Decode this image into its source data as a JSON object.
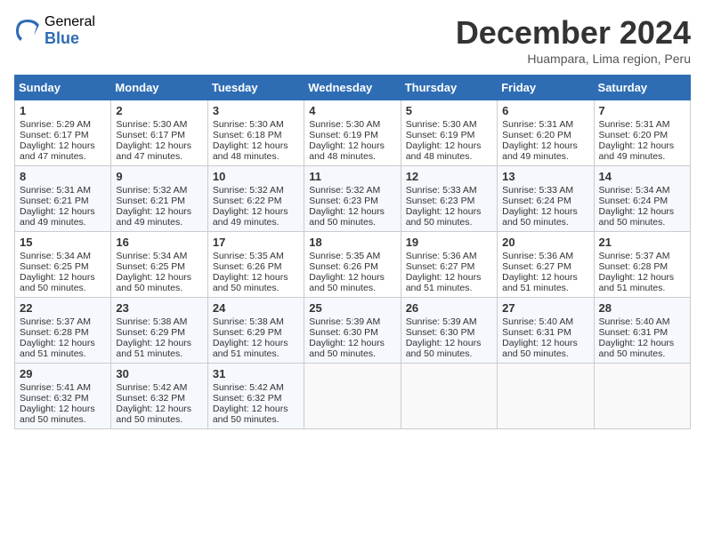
{
  "logo": {
    "general": "General",
    "blue": "Blue"
  },
  "title": "December 2024",
  "location": "Huampara, Lima region, Peru",
  "days_of_week": [
    "Sunday",
    "Monday",
    "Tuesday",
    "Wednesday",
    "Thursday",
    "Friday",
    "Saturday"
  ],
  "weeks": [
    [
      {
        "day": 1,
        "sunrise": "5:29 AM",
        "sunset": "6:17 PM",
        "daylight": "12 hours and 47 minutes."
      },
      {
        "day": 2,
        "sunrise": "5:30 AM",
        "sunset": "6:17 PM",
        "daylight": "12 hours and 47 minutes."
      },
      {
        "day": 3,
        "sunrise": "5:30 AM",
        "sunset": "6:18 PM",
        "daylight": "12 hours and 48 minutes."
      },
      {
        "day": 4,
        "sunrise": "5:30 AM",
        "sunset": "6:19 PM",
        "daylight": "12 hours and 48 minutes."
      },
      {
        "day": 5,
        "sunrise": "5:30 AM",
        "sunset": "6:19 PM",
        "daylight": "12 hours and 48 minutes."
      },
      {
        "day": 6,
        "sunrise": "5:31 AM",
        "sunset": "6:20 PM",
        "daylight": "12 hours and 49 minutes."
      },
      {
        "day": 7,
        "sunrise": "5:31 AM",
        "sunset": "6:20 PM",
        "daylight": "12 hours and 49 minutes."
      }
    ],
    [
      {
        "day": 8,
        "sunrise": "5:31 AM",
        "sunset": "6:21 PM",
        "daylight": "12 hours and 49 minutes."
      },
      {
        "day": 9,
        "sunrise": "5:32 AM",
        "sunset": "6:21 PM",
        "daylight": "12 hours and 49 minutes."
      },
      {
        "day": 10,
        "sunrise": "5:32 AM",
        "sunset": "6:22 PM",
        "daylight": "12 hours and 49 minutes."
      },
      {
        "day": 11,
        "sunrise": "5:32 AM",
        "sunset": "6:23 PM",
        "daylight": "12 hours and 50 minutes."
      },
      {
        "day": 12,
        "sunrise": "5:33 AM",
        "sunset": "6:23 PM",
        "daylight": "12 hours and 50 minutes."
      },
      {
        "day": 13,
        "sunrise": "5:33 AM",
        "sunset": "6:24 PM",
        "daylight": "12 hours and 50 minutes."
      },
      {
        "day": 14,
        "sunrise": "5:34 AM",
        "sunset": "6:24 PM",
        "daylight": "12 hours and 50 minutes."
      }
    ],
    [
      {
        "day": 15,
        "sunrise": "5:34 AM",
        "sunset": "6:25 PM",
        "daylight": "12 hours and 50 minutes."
      },
      {
        "day": 16,
        "sunrise": "5:34 AM",
        "sunset": "6:25 PM",
        "daylight": "12 hours and 50 minutes."
      },
      {
        "day": 17,
        "sunrise": "5:35 AM",
        "sunset": "6:26 PM",
        "daylight": "12 hours and 50 minutes."
      },
      {
        "day": 18,
        "sunrise": "5:35 AM",
        "sunset": "6:26 PM",
        "daylight": "12 hours and 50 minutes."
      },
      {
        "day": 19,
        "sunrise": "5:36 AM",
        "sunset": "6:27 PM",
        "daylight": "12 hours and 51 minutes."
      },
      {
        "day": 20,
        "sunrise": "5:36 AM",
        "sunset": "6:27 PM",
        "daylight": "12 hours and 51 minutes."
      },
      {
        "day": 21,
        "sunrise": "5:37 AM",
        "sunset": "6:28 PM",
        "daylight": "12 hours and 51 minutes."
      }
    ],
    [
      {
        "day": 22,
        "sunrise": "5:37 AM",
        "sunset": "6:28 PM",
        "daylight": "12 hours and 51 minutes."
      },
      {
        "day": 23,
        "sunrise": "5:38 AM",
        "sunset": "6:29 PM",
        "daylight": "12 hours and 51 minutes."
      },
      {
        "day": 24,
        "sunrise": "5:38 AM",
        "sunset": "6:29 PM",
        "daylight": "12 hours and 51 minutes."
      },
      {
        "day": 25,
        "sunrise": "5:39 AM",
        "sunset": "6:30 PM",
        "daylight": "12 hours and 50 minutes."
      },
      {
        "day": 26,
        "sunrise": "5:39 AM",
        "sunset": "6:30 PM",
        "daylight": "12 hours and 50 minutes."
      },
      {
        "day": 27,
        "sunrise": "5:40 AM",
        "sunset": "6:31 PM",
        "daylight": "12 hours and 50 minutes."
      },
      {
        "day": 28,
        "sunrise": "5:40 AM",
        "sunset": "6:31 PM",
        "daylight": "12 hours and 50 minutes."
      }
    ],
    [
      {
        "day": 29,
        "sunrise": "5:41 AM",
        "sunset": "6:32 PM",
        "daylight": "12 hours and 50 minutes."
      },
      {
        "day": 30,
        "sunrise": "5:42 AM",
        "sunset": "6:32 PM",
        "daylight": "12 hours and 50 minutes."
      },
      {
        "day": 31,
        "sunrise": "5:42 AM",
        "sunset": "6:32 PM",
        "daylight": "12 hours and 50 minutes."
      },
      null,
      null,
      null,
      null
    ]
  ],
  "labels": {
    "sunrise": "Sunrise:",
    "sunset": "Sunset:",
    "daylight": "Daylight:"
  }
}
